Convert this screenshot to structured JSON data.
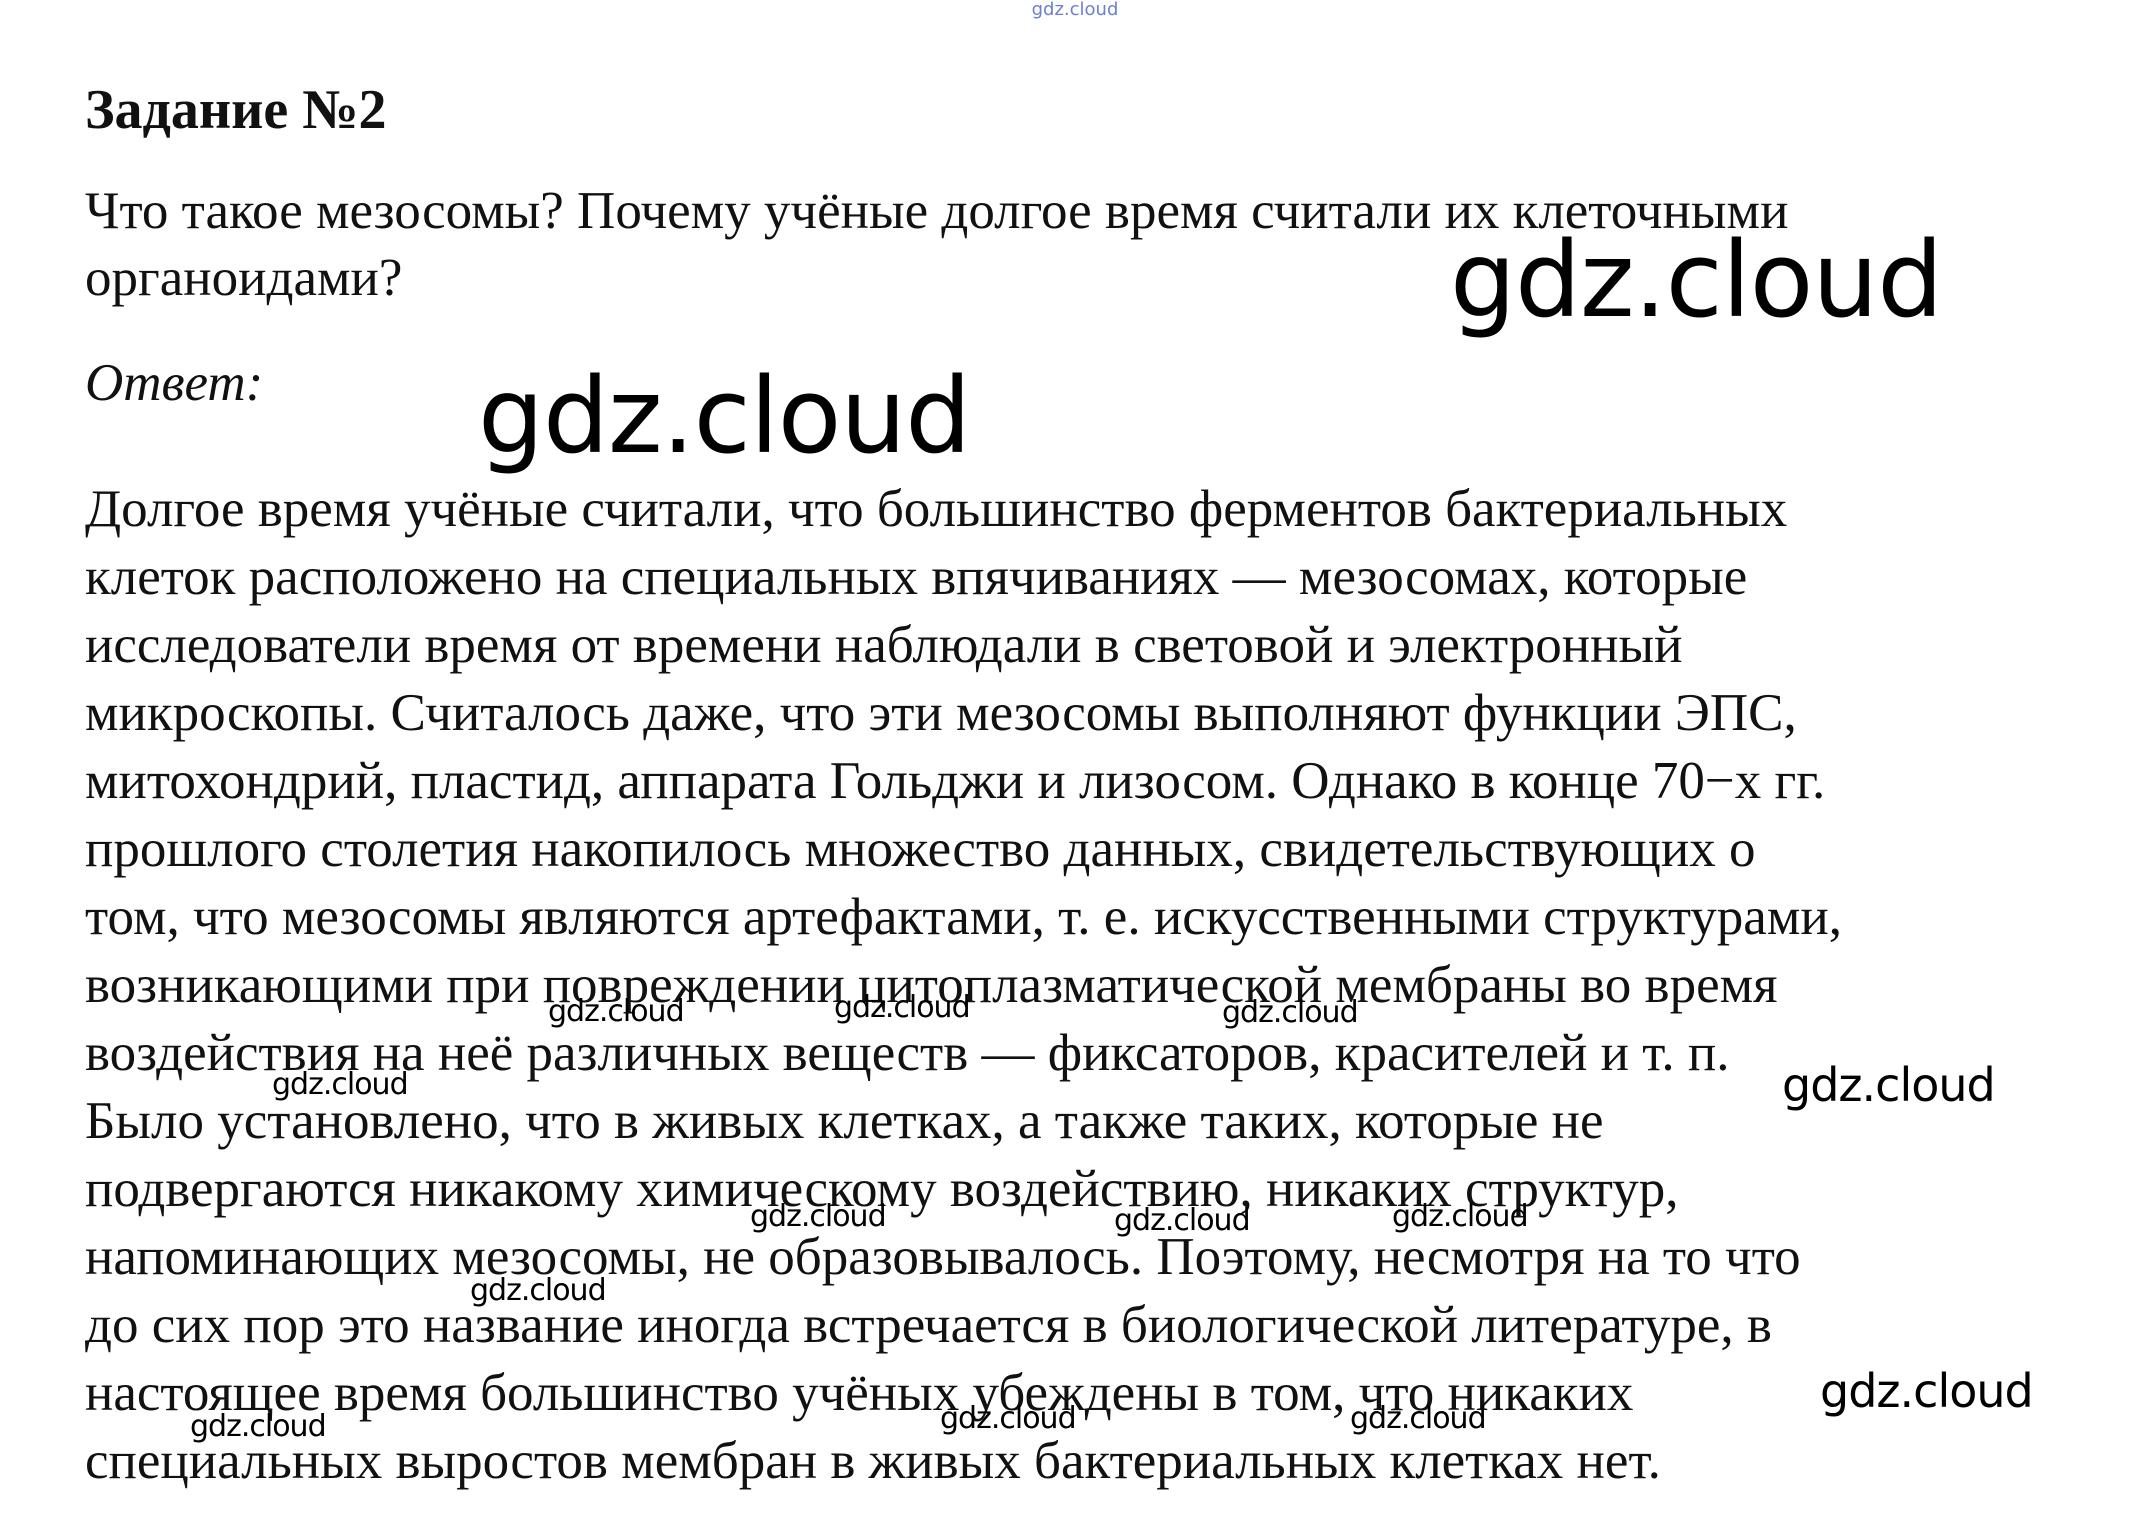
{
  "header": {
    "site_mark": "gdz.cloud"
  },
  "task": {
    "title": "Задание №2",
    "question": "Что такое мезосомы? Почему учёные долгое время считали их клеточными органоидами?",
    "answer_label": "Ответ:",
    "answer_lines": [
      "Долгое время учёные считали, что большинство ферментов бактериальных",
      "клеток расположено на специальных впячиваниях — мезосомах, которые",
      "исследователи время от времени наблюдали в световой и электронный",
      "микроскопы. Считалось даже, что эти мезосомы выполняют функции ЭПС,",
      "митохондрий, пластид, аппарата Гольджи и лизосом. Однако в конце 70−х гг.",
      "прошлого столетия накопилось множество данных, свидетельствующих о",
      "том, что мезосомы являются артефактами, т. е. искусственными структурами,",
      "возникающими при повреждении цитоплазматической мембраны во время",
      "воздействия на неё различных веществ — фиксаторов, красителей и т. п.",
      "Было установлено, что в живых клетках, а также таких, которые не",
      "подвергаются никакому химическому воздействию, никаких структур,",
      "напоминающих мезосомы, не образовывалось. Поэтому, несмотря на то что",
      "до сих пор это название иногда встречается в биологической литературе, в",
      "настоящее время большинство учёных убеждены в том, что никаких",
      "специальных выростов мембран в живых бактериальных клетках нет."
    ]
  },
  "watermarks": {
    "text": "gdz.cloud"
  }
}
